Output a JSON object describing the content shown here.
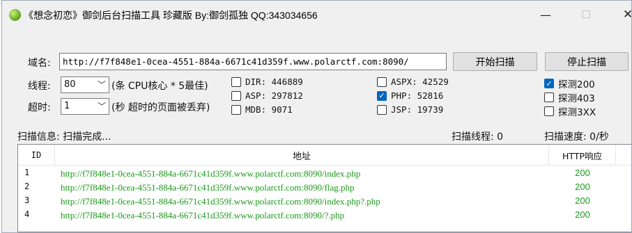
{
  "window": {
    "title": "《想念初恋》御剑后台扫描工具 珍藏版 By:御剑孤独 QQ:343034656",
    "min_glyph": "—",
    "max_glyph": "☐",
    "close_glyph": "✕"
  },
  "form": {
    "domain_label": "域名:",
    "domain_value": "http://f7f848e1-0cea-4551-884a-6671c41d359f.www.polarctf.com:8090/",
    "start_button": "开始扫描",
    "stop_button": "停止扫描",
    "threads_label": "线程:",
    "threads_value": "80",
    "threads_hint": "(条 CPU核心 * 5最佳)",
    "timeout_label": "超时:",
    "timeout_value": "1",
    "timeout_hint": "(秒 超时的页面被丢弃)"
  },
  "dictionaries": [
    {
      "label": "DIR: 446889",
      "checked": false
    },
    {
      "label": "ASP: 297812",
      "checked": false
    },
    {
      "label": "MDB: 9071",
      "checked": false
    },
    {
      "label": "ASPX: 42529",
      "checked": false
    },
    {
      "label": "PHP: 52816",
      "checked": true
    },
    {
      "label": "JSP: 19739",
      "checked": false
    }
  ],
  "probes": [
    {
      "label": "探测200",
      "checked": true
    },
    {
      "label": "探测403",
      "checked": false
    },
    {
      "label": "探测3XX",
      "checked": false
    }
  ],
  "status": {
    "info_label": "扫描信息: 扫描完成...",
    "threads_label": "扫描线程: 0",
    "speed_label": "扫描速度: 0/秒"
  },
  "results": {
    "columns": {
      "id": "ID",
      "url": "地址",
      "http": "HTTP响应"
    },
    "rows": [
      {
        "id": "1",
        "url": "http://f7f848e1-0cea-4551-884a-6671c41d359f.www.polarctf.com:8090/index.php",
        "code": "200"
      },
      {
        "id": "2",
        "url": "http://f7f848e1-0cea-4551-884a-6671c41d359f.www.polarctf.com:8090/flag.php",
        "code": "200"
      },
      {
        "id": "3",
        "url": "http://f7f848e1-0cea-4551-884a-6671c41d359f.www.polarctf.com:8090/index.php?.php",
        "code": "200"
      },
      {
        "id": "4",
        "url": "http://f7f848e1-0cea-4551-884a-6671c41d359f.www.polarctf.com:8090/?.php",
        "code": "200"
      }
    ]
  },
  "colors": {
    "result_text": "#1a9a1a",
    "check_accent": "#0067c0"
  }
}
